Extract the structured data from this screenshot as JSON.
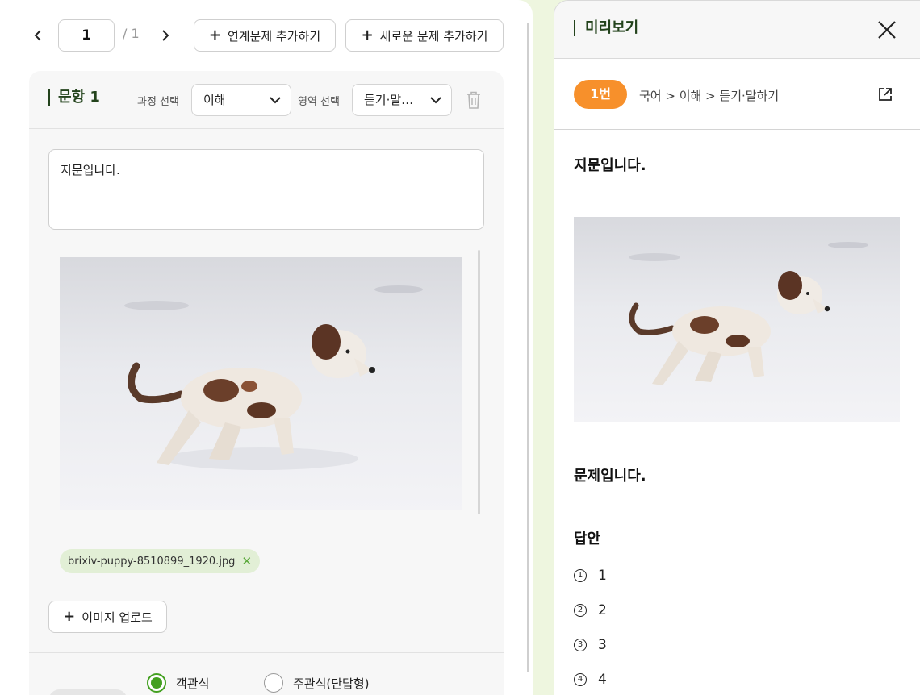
{
  "pager": {
    "current_page": "1",
    "total": "/ 1",
    "prev_icon": "chevron-left-icon",
    "next_icon": "chevron-right-icon"
  },
  "toolbar": {
    "add_linked_label": "연계문제 추가하기",
    "add_new_label": "새로운 문제 추가하기"
  },
  "item": {
    "title": "문항 1",
    "course_label": "과정 선택",
    "course_value": "이해",
    "area_label": "영역 선택",
    "area_value": "듣기·말…",
    "passage": "지문입니다.",
    "file_name": "brixiv-puppy-8510899_1920.jpg",
    "upload_label": "이미지 업로드",
    "radio_objective": "객관식",
    "radio_subjective": "주관식(단답형)",
    "selected_type": "객관식"
  },
  "preview": {
    "title": "미리보기",
    "badge": "1번",
    "breadcrumb": "국어 > 이해 > 듣기·말하기",
    "passage": "지문입니다.",
    "question": "문제입니다.",
    "answer_heading": "답안",
    "options": [
      {
        "mark": "1",
        "text": "1"
      },
      {
        "mark": "2",
        "text": "2"
      },
      {
        "mark": "3",
        "text": "3"
      },
      {
        "mark": "4",
        "text": "4"
      }
    ]
  },
  "colors": {
    "accent_green": "#43a020",
    "badge_orange": "#f7902b",
    "title_green": "#23431c",
    "page_bg": "#eef6df"
  }
}
